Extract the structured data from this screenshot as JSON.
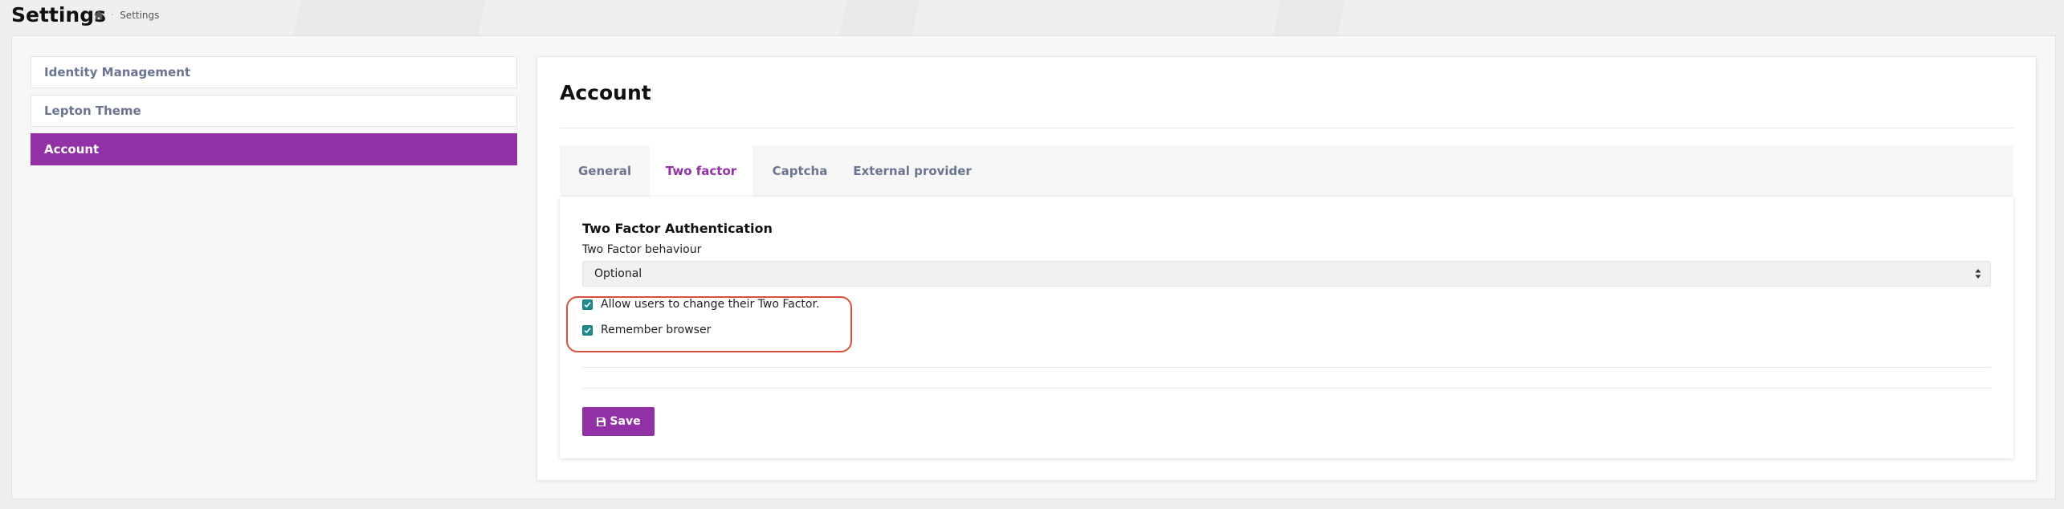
{
  "header": {
    "title": "Settings",
    "breadcrumb": {
      "home_icon": "home-icon",
      "current": "Settings"
    }
  },
  "sidebar": {
    "items": [
      {
        "label": "Identity Management",
        "active": false
      },
      {
        "label": "Lepton Theme",
        "active": false
      },
      {
        "label": "Account",
        "active": true
      }
    ]
  },
  "main": {
    "title": "Account",
    "tabs": [
      {
        "label": "General",
        "active": false
      },
      {
        "label": "Two factor",
        "active": true
      },
      {
        "label": "Captcha",
        "active": false
      },
      {
        "label": "External provider",
        "active": false
      }
    ],
    "two_factor": {
      "heading": "Two Factor Authentication",
      "behaviour_label": "Two Factor behaviour",
      "behaviour_value": "Optional",
      "options": [
        {
          "label": "Allow users to change their Two Factor.",
          "checked": true
        },
        {
          "label": "Remember browser",
          "checked": true
        }
      ]
    },
    "save_label": "Save",
    "save_icon": "floppy-disk-icon"
  },
  "colors": {
    "accent": "#9230a6",
    "checkbox": "#1f8a8f",
    "highlight_ring": "#d8503c",
    "muted_text": "#6b7491"
  }
}
